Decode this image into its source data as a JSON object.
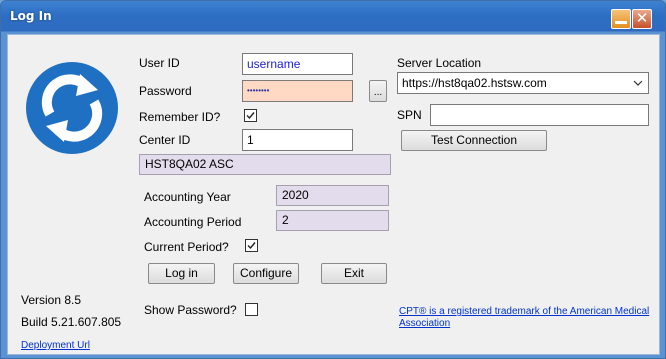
{
  "window": {
    "title": "Log In"
  },
  "form": {
    "user_id_label": "User ID",
    "user_id_value": "username",
    "password_label": "Password",
    "password_value": "••••••••",
    "password_button_label": "...",
    "remember_label": "Remember ID?",
    "remember_checked": true,
    "center_id_label": "Center ID",
    "center_id_value": "1",
    "center_name": "HST8QA02 ASC",
    "acct_year_label": "Accounting Year",
    "acct_year_value": "2020",
    "acct_period_label": "Accounting Period",
    "acct_period_value": "2",
    "current_period_label": "Current Period?",
    "current_period_checked": true,
    "show_password_label": "Show Password?",
    "show_password_checked": false
  },
  "buttons": {
    "login": "Log in",
    "configure": "Configure",
    "exit": "Exit",
    "test_connection": "Test Connection"
  },
  "server": {
    "location_label": "Server Location",
    "location_value": "https://hst8qa02.hstsw.com",
    "spn_label": "SPN",
    "spn_value": ""
  },
  "footer": {
    "version": "Version 8.5",
    "build": "Build 5.21.607.805",
    "deployment_link": "Deployment Url",
    "cpt_line1": "CPT® is a registered trademark of the American Medical",
    "cpt_line2": "Association"
  },
  "colors": {
    "logo_blue": "#1f6fc2",
    "password_bg": "#ffd9c4",
    "readonly_bg": "#e3dcec",
    "link": "#0033cc"
  },
  "icons": {
    "logo": "sync-arrows-icon",
    "minimize": "minimize-icon",
    "close": "close-icon"
  }
}
